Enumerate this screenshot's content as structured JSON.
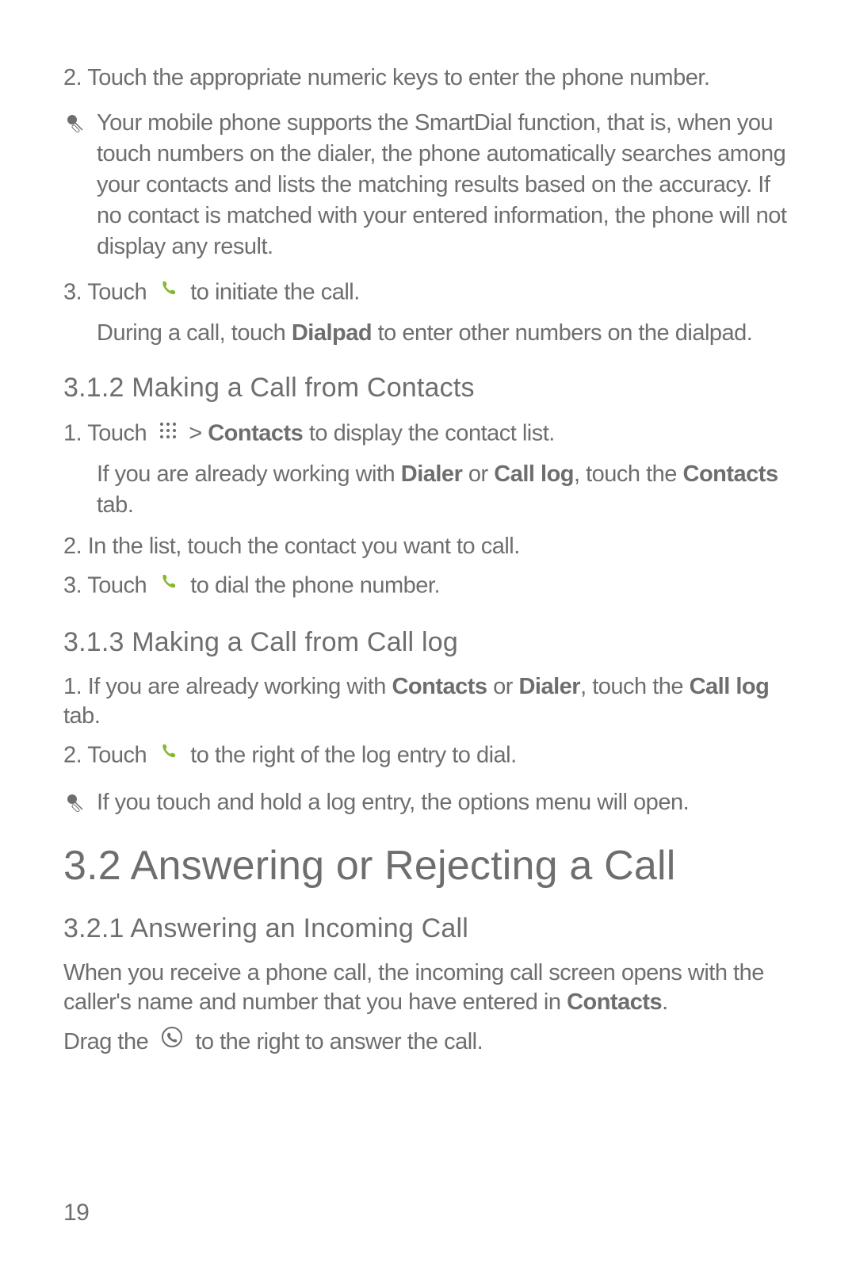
{
  "steps": {
    "s2_numeric": "2. Touch the appropriate numeric keys to enter the phone number.",
    "note_smartdial": "Your mobile phone supports the SmartDial function, that is, when you touch numbers on the dialer, the phone automatically searches among your contacts and lists the matching results based on the accuracy. If no contact is matched with your entered information, the phone will not display any result.",
    "s3_touch_pre": "3. Touch ",
    "s3_touch_post": " to initiate the call.",
    "s3_sub_pre": "During a call, touch ",
    "s3_sub_bold": "Dialpad",
    "s3_sub_post": " to enter other numbers on the dialpad."
  },
  "sec312": {
    "heading": "3.1.2  Making a Call from Contacts",
    "s1_pre": "1. Touch ",
    "s1_mid": " > ",
    "s1_bold": "Contacts",
    "s1_post": " to display the contact list.",
    "s1_sub_pre": "If you are already working with ",
    "s1_sub_b1": "Dialer",
    "s1_sub_mid1": " or ",
    "s1_sub_b2": "Call log",
    "s1_sub_mid2": ", touch the ",
    "s1_sub_b3": "Contacts",
    "s1_sub_post": " tab.",
    "s2": "2. In the list, touch the contact you want to call.",
    "s3_pre": "3. Touch ",
    "s3_post": " to dial the phone number."
  },
  "sec313": {
    "heading": "3.1.3  Making a Call from Call log",
    "s1_pre": "1. If you are already working with ",
    "s1_b1": "Contacts",
    "s1_mid1": " or ",
    "s1_b2": "Dialer",
    "s1_mid2": ", touch the ",
    "s1_b3": "Call log",
    "s1_post": " tab.",
    "s2_pre": "2. Touch ",
    "s2_post": " to the right of the log entry to dial.",
    "note": "If you touch and hold a log entry, the options menu will open."
  },
  "sec32": {
    "heading": "3.2  Answering or Rejecting a Call"
  },
  "sec321": {
    "heading": "3.2.1  Answering an Incoming Call",
    "p1_pre": "When you receive a phone call, the incoming call screen opens with the caller's name and number that you have entered in ",
    "p1_bold": "Contacts",
    "p1_post": ".",
    "p2_pre": "Drag the ",
    "p2_post": " to the right to answer the call."
  },
  "page_number": "19"
}
